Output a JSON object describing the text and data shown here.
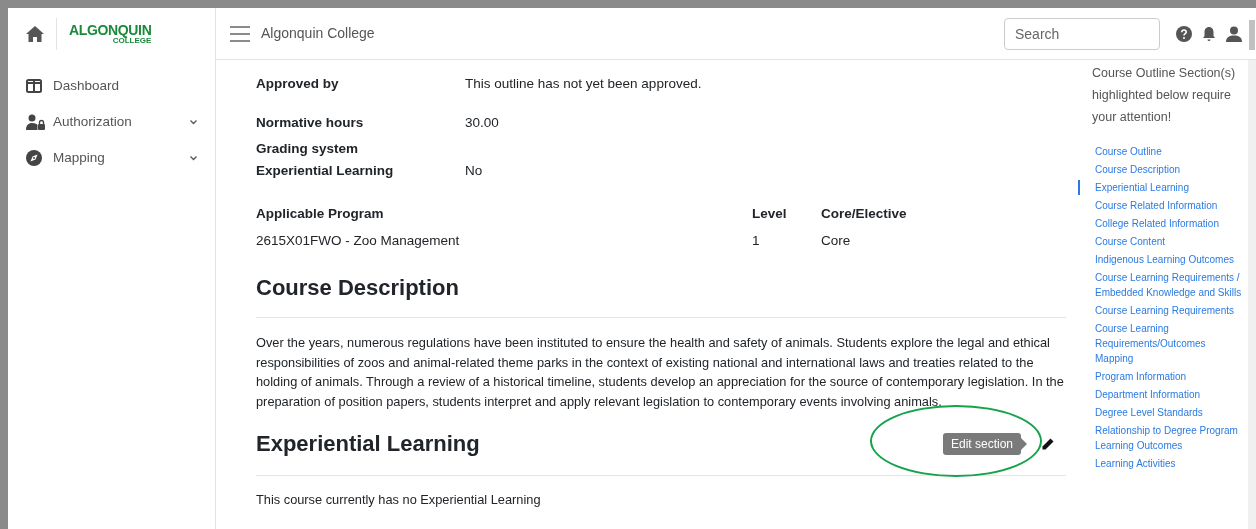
{
  "brand": {
    "logo_top": "ALGONQUIN",
    "logo_bottom": "COLLEGE"
  },
  "sidebar": {
    "items": [
      {
        "label": "Dashboard",
        "expandable": false
      },
      {
        "label": "Authorization",
        "expandable": true
      },
      {
        "label": "Mapping",
        "expandable": true
      }
    ]
  },
  "topbar": {
    "title": "Algonquin College",
    "search": {
      "placeholder": "Search"
    }
  },
  "details": [
    {
      "label": "Approved by",
      "value": "This outline has not yet been approved."
    },
    {
      "label": "Normative hours",
      "value": "30.00"
    },
    {
      "label": "Grading system"
    },
    {
      "label": "Experiential Learning",
      "value": "No"
    }
  ],
  "program_table": {
    "columns": [
      "Applicable Program",
      "Level",
      "Core/Elective"
    ],
    "rows": [
      [
        "2615X01FWO - Zoo Management",
        "1",
        "Core"
      ]
    ]
  },
  "sections": [
    {
      "heading": "Course Description",
      "editable": false,
      "text": "Over the years, numerous regulations have been instituted to ensure the health and safety of animals. Students explore the legal and ethical responsibilities of zoos and animal-related theme parks in the context of existing national and international laws and treaties related to the holding of animals. Through a review of a historical timeline, students develop an appreciation for the source of contemporary legislation. In the preparation of position papers, students interpret and apply relevant legislation to contemporary events involving animals."
    },
    {
      "heading": "Experiential Learning",
      "editable": true,
      "tooltip": "Edit section",
      "text": "This course currently has no Experiential Learning"
    }
  ],
  "outline_nav": {
    "notice": "Course Outline Section(s) highlighted below require your attention!",
    "items": [
      {
        "label": "Course Outline",
        "selected": false
      },
      {
        "label": "Course Description",
        "selected": false
      },
      {
        "label": "Experiential Learning",
        "selected": true
      },
      {
        "label": "Course Related Information",
        "selected": false
      },
      {
        "label": "College Related Information",
        "selected": false
      },
      {
        "label": "Course Content",
        "selected": false
      },
      {
        "label": "Indigenous Learning Outcomes",
        "selected": false
      },
      {
        "label": "Course Learning Requirements / Embedded Knowledge and Skills",
        "selected": false
      },
      {
        "label": "Course Learning Requirements",
        "selected": false
      },
      {
        "label": "Course Learning Requirements/Outcomes Mapping",
        "selected": false
      },
      {
        "label": "Program Information",
        "selected": false
      },
      {
        "label": "Department Information",
        "selected": false
      },
      {
        "label": "Degree Level Standards",
        "selected": false
      },
      {
        "label": "Relationship to Degree Program Learning Outcomes",
        "selected": false
      },
      {
        "label": "Learning Activities",
        "selected": false
      }
    ]
  }
}
